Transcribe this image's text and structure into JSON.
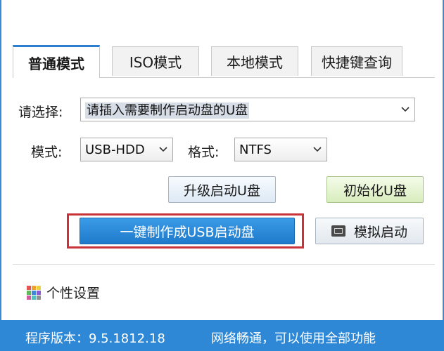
{
  "tabs": [
    {
      "label": "普通模式",
      "active": true
    },
    {
      "label": "ISO模式",
      "active": false
    },
    {
      "label": "本地模式",
      "active": false
    },
    {
      "label": "快捷键查询",
      "active": false
    }
  ],
  "select_disk": {
    "label": "请选择:",
    "value": "请插入需要制作启动盘的U盘"
  },
  "mode": {
    "label": "模式:",
    "value": "USB-HDD"
  },
  "format": {
    "label": "格式:",
    "value": "NTFS"
  },
  "buttons": {
    "upgrade": "升级启动U盘",
    "init": "初始化U盘",
    "make": "一键制作成USB启动盘",
    "simulate": "模拟启动"
  },
  "settings": {
    "label": "个性设置"
  },
  "status": {
    "version": "程序版本：9.5.1812.18",
    "network": "网络畅通，可以使用全部功能"
  },
  "colors": {
    "accent": "#2f88d6",
    "highlight_border": "#c8333a",
    "main_button": "#1f7acb"
  },
  "icons": [
    "chevron-down-icon",
    "monitor-icon",
    "color-grid-icon"
  ]
}
